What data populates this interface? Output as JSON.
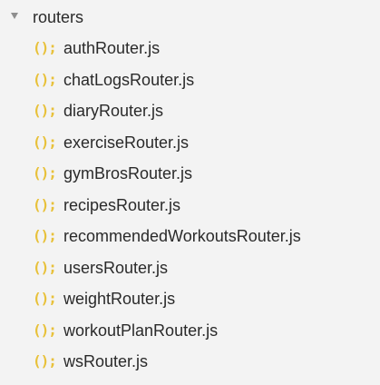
{
  "folder": {
    "name": "routers",
    "icon": "chevron-down-icon",
    "expanded": true
  },
  "file_icon": {
    "glyph": "();",
    "name": "js-file-icon",
    "color": "#e8c13a"
  },
  "files": [
    {
      "label": "authRouter.js"
    },
    {
      "label": "chatLogsRouter.js"
    },
    {
      "label": "diaryRouter.js"
    },
    {
      "label": "exerciseRouter.js"
    },
    {
      "label": "gymBrosRouter.js"
    },
    {
      "label": "recipesRouter.js"
    },
    {
      "label": "recommendedWorkoutsRouter.js"
    },
    {
      "label": "usersRouter.js"
    },
    {
      "label": "weightRouter.js"
    },
    {
      "label": "workoutPlanRouter.js"
    },
    {
      "label": "wsRouter.js"
    }
  ]
}
